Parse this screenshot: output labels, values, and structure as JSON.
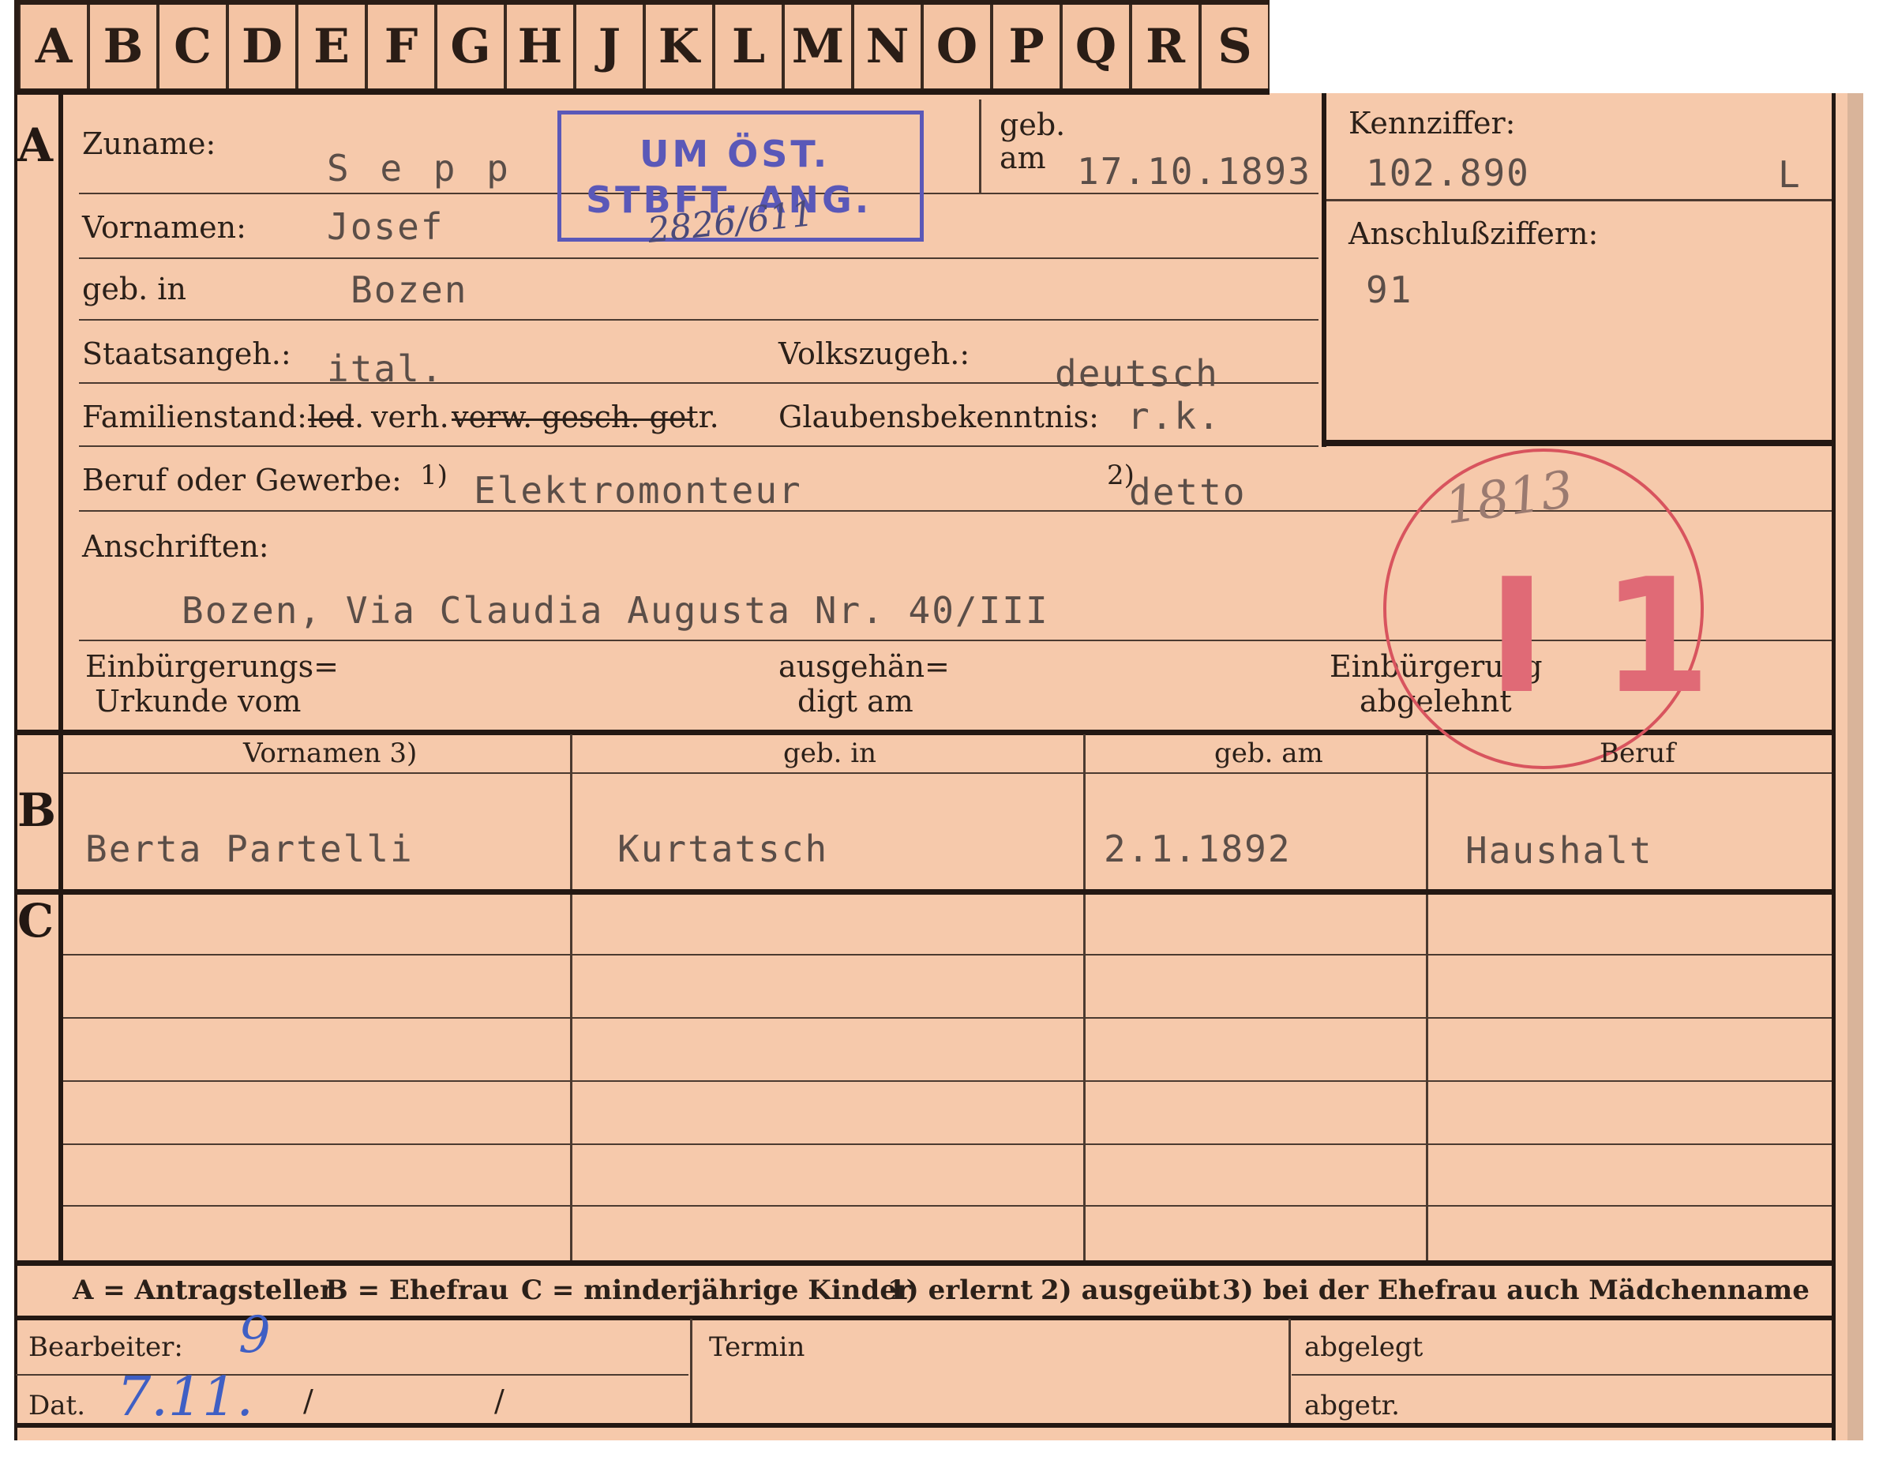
{
  "tabs": [
    "A",
    "B",
    "C",
    "D",
    "E",
    "F",
    "G",
    "H",
    "J",
    "K",
    "L",
    "M",
    "N",
    "O",
    "P",
    "Q",
    "R",
    "S"
  ],
  "sections": {
    "a": "A",
    "b": "B",
    "c": "C"
  },
  "labels": {
    "zuname": "Zuname:",
    "vornamen": "Vornamen:",
    "geb_in": "geb. in",
    "geb": "geb.",
    "am": "am",
    "kennziffer": "Kennziffer:",
    "anschlussziffern": "Anschlußziffern:",
    "staatsangeh": "Staatsangeh.:",
    "volkszugeh": "Volkszugeh.:",
    "familienstand": "Familienstand:",
    "fam_led": "led.",
    "fam_verh": "verh.",
    "fam_rest": "verw. gesch. getr.",
    "glaubensbekenntnis": "Glaubensbekenntnis:",
    "beruf": "Beruf oder Gewerbe:",
    "note1": "1)",
    "note2": "2)",
    "anschriften": "Anschriften:",
    "einb_urkunde_1": "Einbürgerungs=",
    "einb_urkunde_2": "Urkunde vom",
    "ausgeh_1": "ausgehän=",
    "ausgeh_2": "digt am",
    "einb_abg_1": "Einbürgerung",
    "einb_abg_2": "abgelehnt"
  },
  "person": {
    "zuname": "S e p p",
    "vornamen": "Josef",
    "geb_in": "Bozen",
    "geb_am": "17.10.1893",
    "kennziffer": "102.890",
    "kennziffer_suffix": "L",
    "anschlussziffern": "91",
    "staatsangeh": "ital.",
    "volkszugeh": "deutsch",
    "glaubensbekenntnis": "r.k.",
    "beruf_erlernt": "Elektromonteur",
    "beruf_ausgeuebt": "detto",
    "anschrift": "Bozen, Via Claudia Augusta Nr. 40/III"
  },
  "stamp": {
    "line1": "UM ÖST.",
    "line2": "STBFT. ANG.",
    "handwritten": "2826/611"
  },
  "circle_stamp": {
    "number": "I 1",
    "handwritten": "1813"
  },
  "table": {
    "headers": [
      "Vornamen 3)",
      "geb. in",
      "geb. am",
      "Beruf"
    ],
    "spouse": [
      "Berta Partelli",
      "Kurtatsch",
      "2.1.1892",
      "Haushalt"
    ]
  },
  "legend": {
    "a": "A = Antragsteller",
    "b": "B = Ehefrau",
    "c": "C = minderjährige Kinder",
    "n1": "1) erlernt",
    "n2": "2) ausgeübt",
    "n3": "3) bei der Ehefrau auch Mädchenname"
  },
  "footer": {
    "bearbeiter": "Bearbeiter:",
    "bearbeiter_value": "9",
    "dat": "Dat.",
    "dat_value": "7.11.",
    "dat_slash1": "/",
    "dat_slash2": "/",
    "termin": "Termin",
    "abgelegt": "abgelegt",
    "abgetr": "abgetr."
  },
  "colors": {
    "card": "#f6c9ab",
    "ink": "#2b2019",
    "stamp_blue": "#5a58b8",
    "stamp_red": "#d8545e",
    "pen_blue": "#3f5fc4"
  }
}
